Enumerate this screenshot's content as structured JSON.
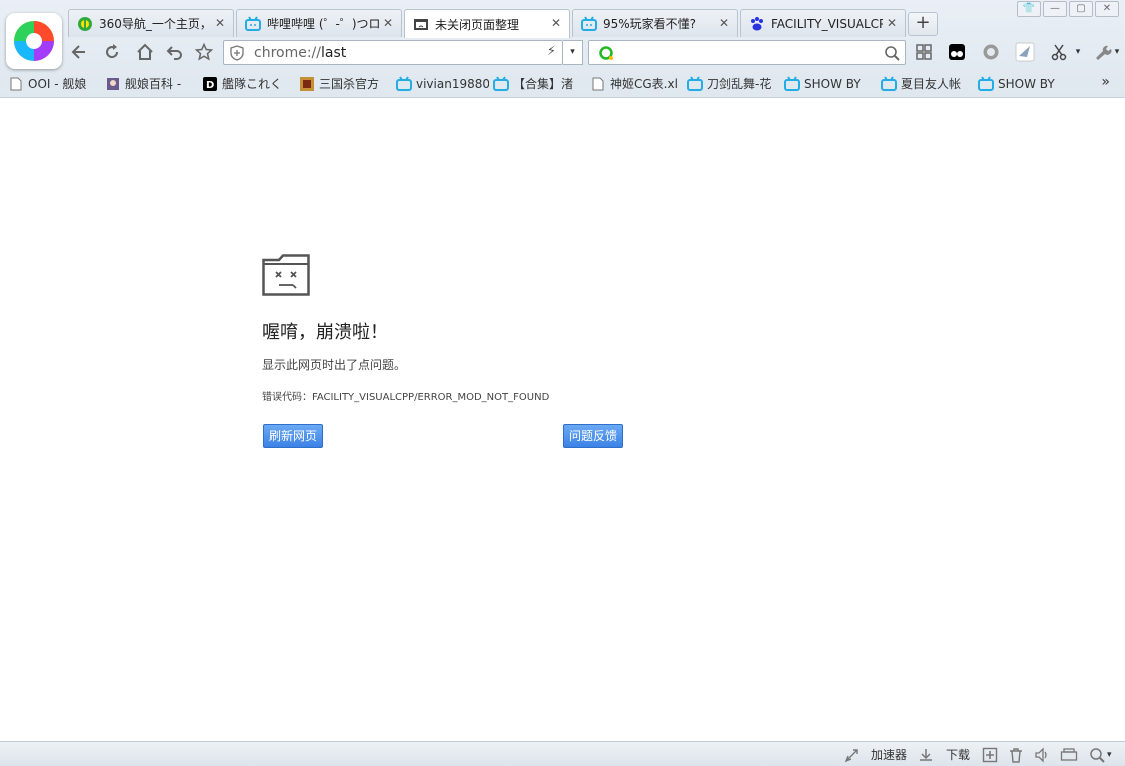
{
  "tabs": [
    {
      "title": "360导航_一个主页，",
      "favicon": "360-nav-icon"
    },
    {
      "title": "哔哩哔哩 (゜-゜)つロ",
      "favicon": "bilibili-icon"
    },
    {
      "title": "未关闭页面整理",
      "favicon": "sad-folder-icon",
      "active": true
    },
    {
      "title": "95%玩家看不懂?",
      "favicon": "bilibili-icon"
    },
    {
      "title": "FACILITY_VISUALCP",
      "favicon": "baidu-paw-icon"
    }
  ],
  "newtab_label": "+",
  "address": {
    "scheme": "chrome://",
    "path": "last"
  },
  "address_dropdown": "▾",
  "bookmarks": [
    {
      "label": "OOI - 舰娘",
      "icon": "page-icon"
    },
    {
      "label": "舰娘百科 -",
      "icon": "kancolle-icon"
    },
    {
      "label": "艦隊これく",
      "icon": "dmm-icon"
    },
    {
      "label": "三国杀官方",
      "icon": "sanguosha-icon"
    },
    {
      "label": "vivian19880",
      "icon": "bilibili-icon"
    },
    {
      "label": "【合集】渚",
      "icon": "bilibili-icon"
    },
    {
      "label": "神姬CG表.xl",
      "icon": "page-icon"
    },
    {
      "label": "刀剑乱舞-花",
      "icon": "bilibili-icon"
    },
    {
      "label": "SHOW BY",
      "icon": "bilibili-icon"
    },
    {
      "label": "夏目友人帐",
      "icon": "bilibili-icon"
    },
    {
      "label": "SHOW BY",
      "icon": "bilibili-icon"
    }
  ],
  "bookmarks_more": "»",
  "crash": {
    "title": "喔唷，崩溃啦！",
    "description": "显示此网页时出了点问题。",
    "error_label": "错误代码：",
    "error_code": "FACILITY_VISUALCPP/ERROR_MOD_NOT_FOUND",
    "reload_button": "刷新网页",
    "feedback_button": "问题反馈"
  },
  "statusbar": {
    "accelerator": "加速器",
    "download": "下载"
  },
  "colors": {
    "accent": "#3c82e6",
    "bilibili": "#23ade5"
  }
}
